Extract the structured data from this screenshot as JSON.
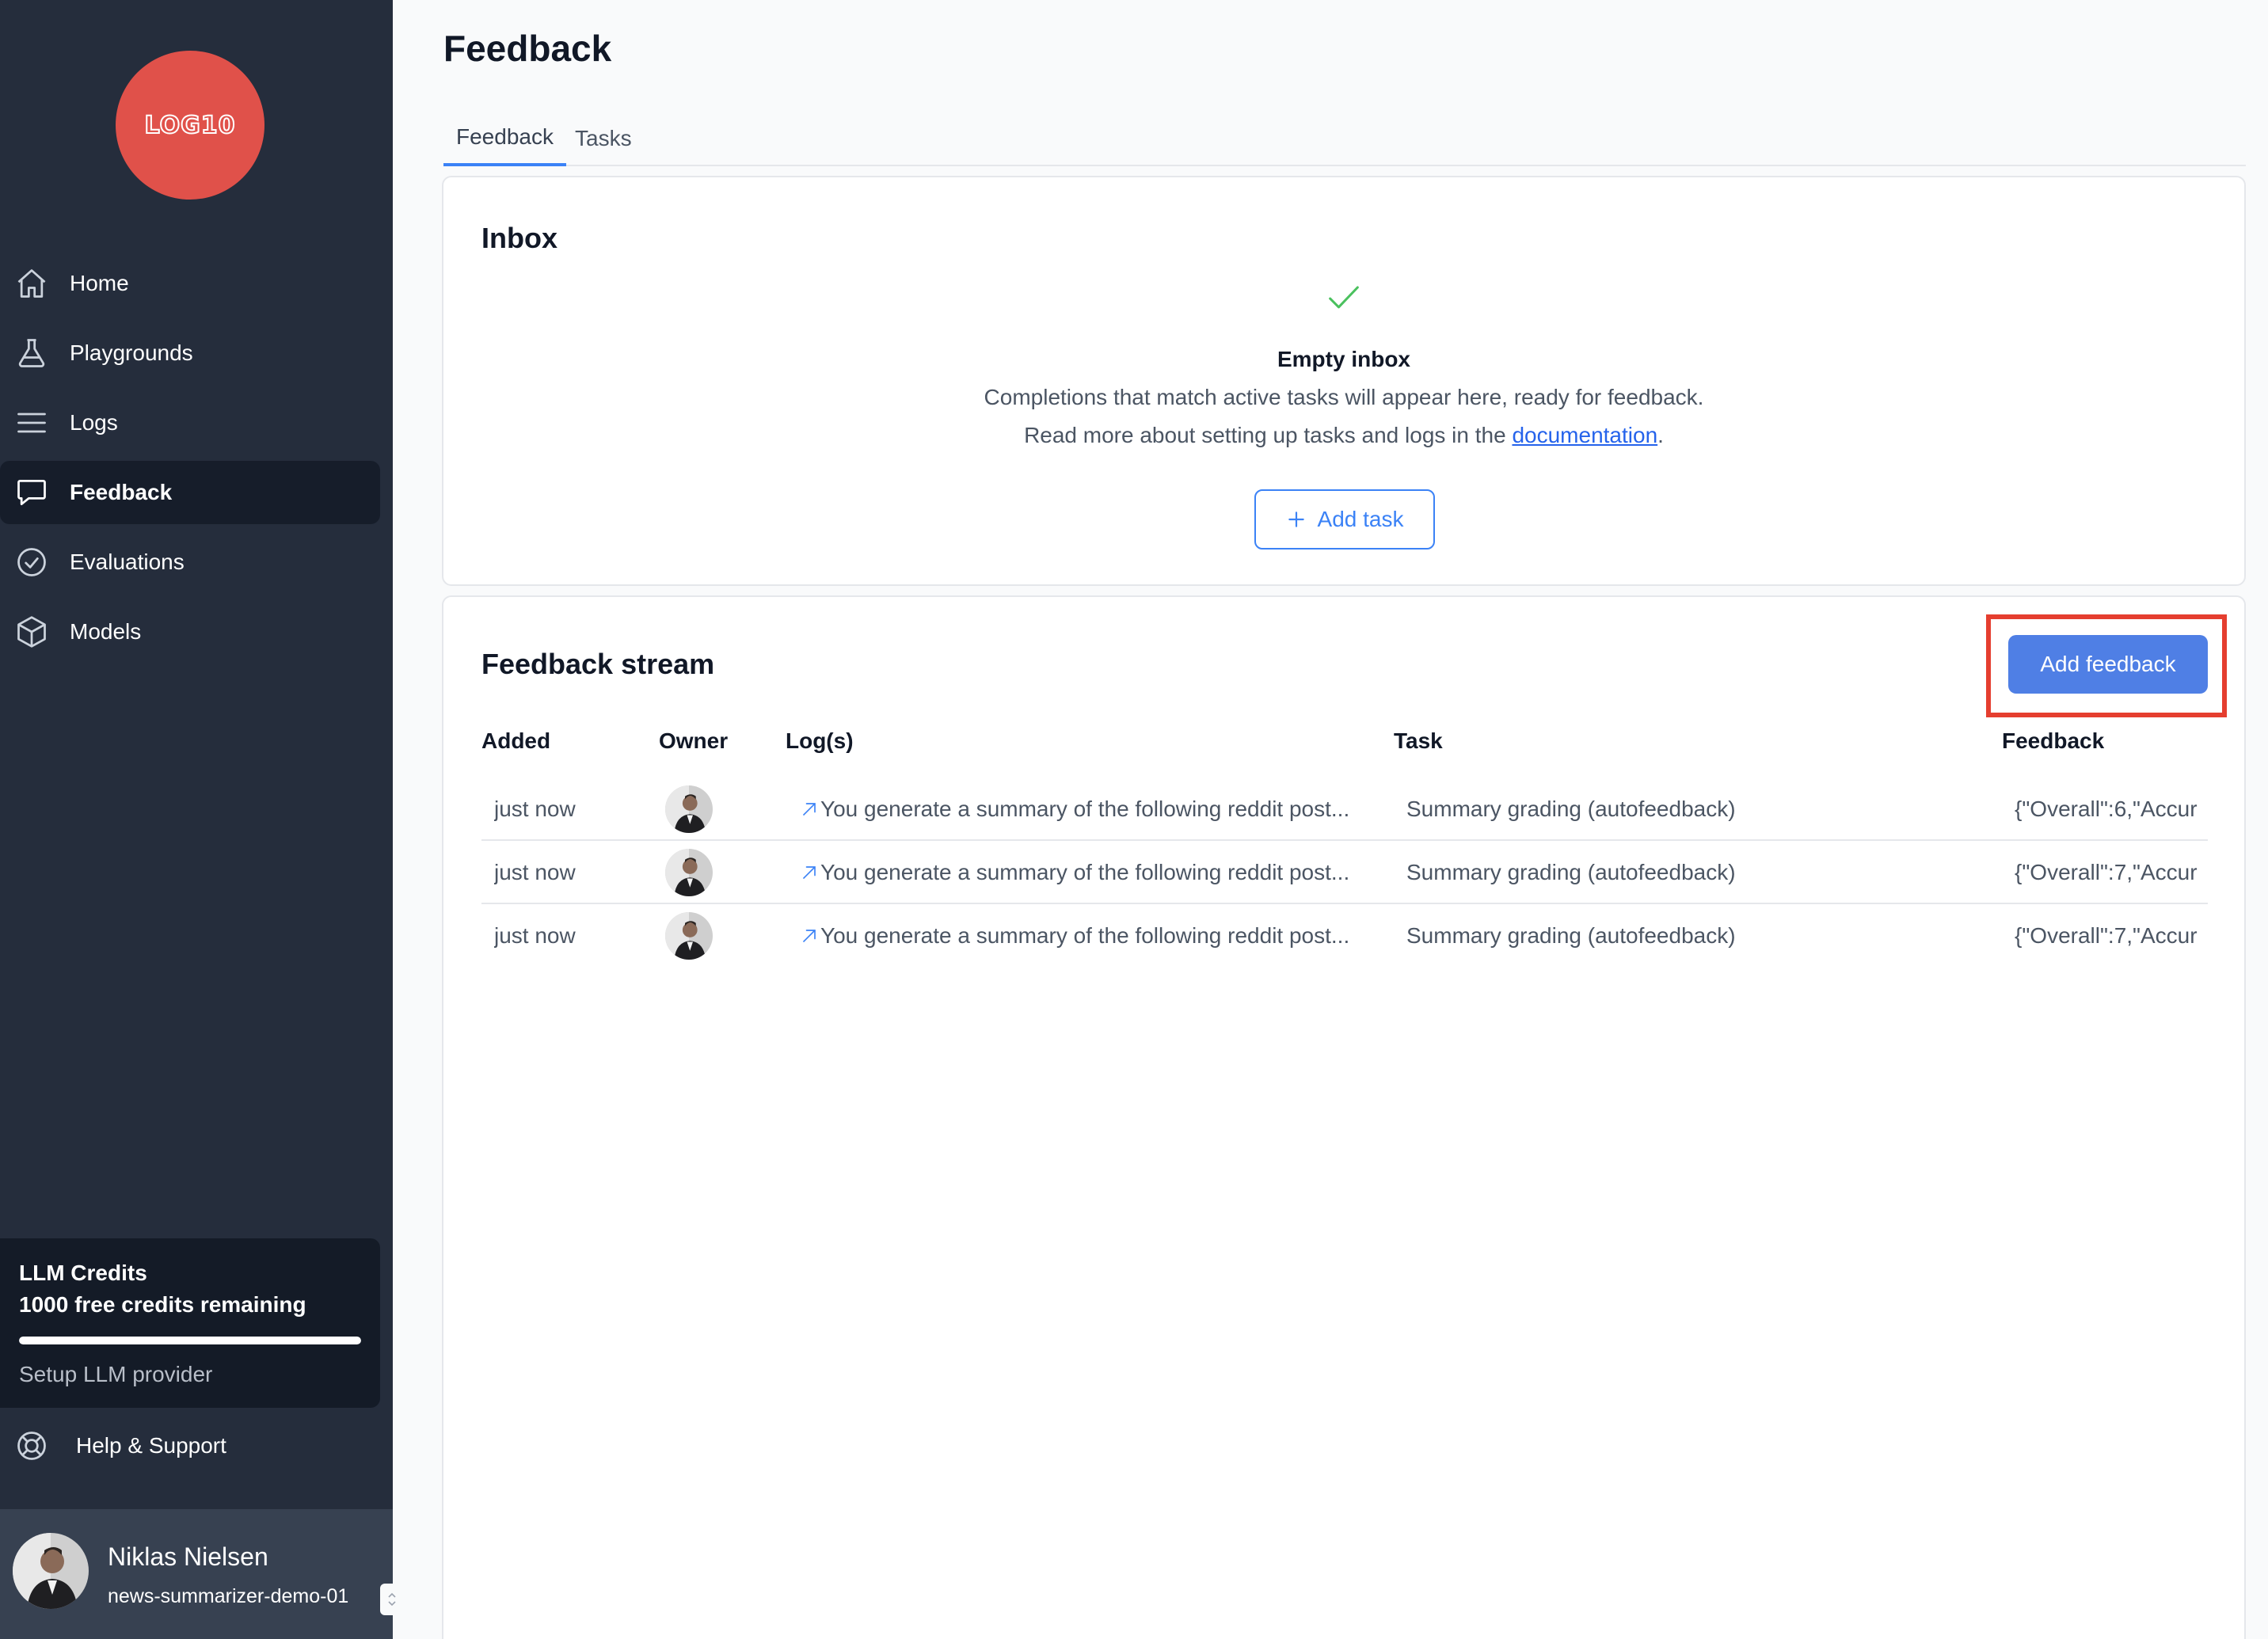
{
  "sidebar": {
    "logo_text": "LOG10",
    "items": [
      {
        "label": "Home",
        "icon": "home-icon"
      },
      {
        "label": "Playgrounds",
        "icon": "flask-icon"
      },
      {
        "label": "Logs",
        "icon": "list-icon"
      },
      {
        "label": "Feedback",
        "icon": "chat-bubble-icon",
        "active": true
      },
      {
        "label": "Evaluations",
        "icon": "check-circle-icon"
      },
      {
        "label": "Models",
        "icon": "cube-icon"
      }
    ],
    "credits": {
      "title": "LLM Credits",
      "remaining": "1000 free credits remaining",
      "progress": 1.0,
      "setup_label": "Setup LLM provider"
    },
    "help_label": "Help & Support",
    "user": {
      "name": "Niklas Nielsen",
      "project": "news-summarizer-demo-01"
    }
  },
  "main": {
    "title": "Feedback",
    "tabs": [
      {
        "label": "Feedback",
        "active": true
      },
      {
        "label": "Tasks",
        "active": false
      }
    ],
    "inbox": {
      "title": "Inbox",
      "empty_title": "Empty inbox",
      "empty_line1": "Completions that match active tasks will appear here, ready for feedback.",
      "empty_line2_prefix": "Read more about setting up tasks and logs in the ",
      "empty_line2_link": "documentation",
      "empty_line2_suffix": ".",
      "add_task_label": "Add task"
    },
    "stream": {
      "title": "Feedback stream",
      "add_feedback_label": "Add feedback",
      "columns": [
        "Added",
        "Owner",
        "Log(s)",
        "Task",
        "Feedback"
      ],
      "rows": [
        {
          "added": "just now",
          "log": "You generate a summary of the following reddit post...",
          "task": "Summary grading (autofeedback)",
          "feedback": "{\"Overall\":6,\"Accur"
        },
        {
          "added": "just now",
          "log": "You generate a summary of the following reddit post...",
          "task": "Summary grading (autofeedback)",
          "feedback": "{\"Overall\":7,\"Accur"
        },
        {
          "added": "just now",
          "log": "You generate a summary of the following reddit post...",
          "task": "Summary grading (autofeedback)",
          "feedback": "{\"Overall\":7,\"Accur"
        }
      ]
    }
  },
  "colors": {
    "sidebar_bg": "#252d3c",
    "accent": "#3b82f6",
    "logo": "#e0514a",
    "highlight_box": "#e53e2f"
  }
}
